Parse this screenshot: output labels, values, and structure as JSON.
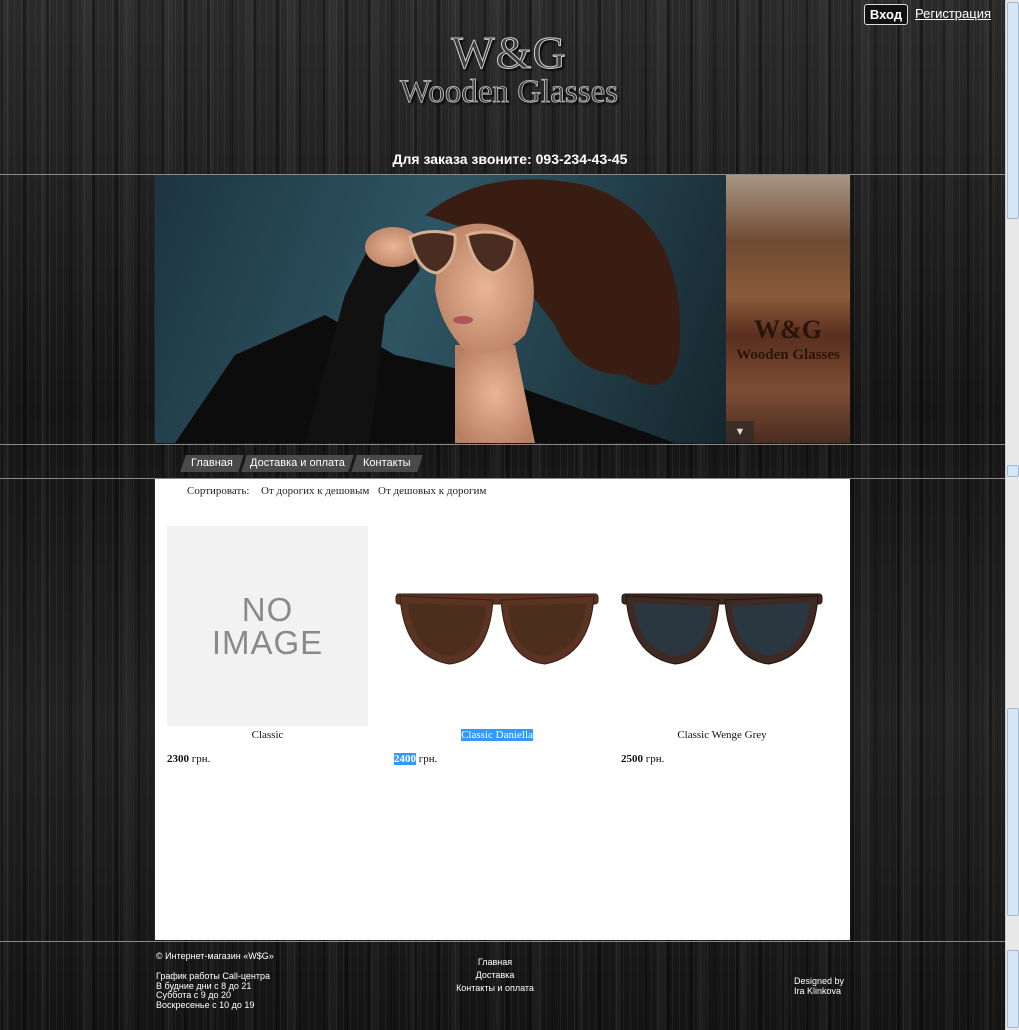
{
  "header": {
    "login_label": "Вход",
    "register_label": "Регистрация",
    "logo_line1": "W&G",
    "logo_line2": "Wooden Glasses",
    "phone_text": "Для заказа звоните: 093-234-43-45"
  },
  "slider": {
    "side_logo_line1": "W&G",
    "side_logo_line2": "Wooden Glasses",
    "arrow": "▼"
  },
  "nav": {
    "items": [
      {
        "label": "Главная"
      },
      {
        "label": "Доставка и оплата"
      },
      {
        "label": "Контакты"
      }
    ]
  },
  "sort": {
    "label": "Сортировать:",
    "options": [
      "От дорогих к дешовым",
      "От дешовых к дорогим"
    ]
  },
  "products": [
    {
      "name": "Classic",
      "price": "2300",
      "currency": "грн.",
      "image": "NO IMAGE",
      "noimg_line1": "NO",
      "noimg_line2": "IMAGE"
    },
    {
      "name": "Classic Daniella",
      "price": "2400",
      "currency": "грн.",
      "lens_color": "#4a2e1c"
    },
    {
      "name": "Classic Wenge Grey",
      "price": "2500",
      "currency": "грн.",
      "lens_color": "#2a3640"
    }
  ],
  "footer": {
    "copyright": "© Интернет-магазин «W$G»",
    "schedule_title": "График работы Call-центра",
    "schedule": [
      "В будние дни с 8 до 21",
      "Суббота с 9 до 20",
      "Воскресенье с 10 до 19"
    ],
    "links": [
      "Главная",
      "Доставка",
      "Контакты и оплата"
    ],
    "designed_by_line1": "Designed by",
    "designed_by_line2": "Ira Klinkova"
  },
  "colors": {
    "selection": "#3399ff",
    "content_bg": "#ffffff",
    "nav_bg": "#4a4a4a"
  }
}
